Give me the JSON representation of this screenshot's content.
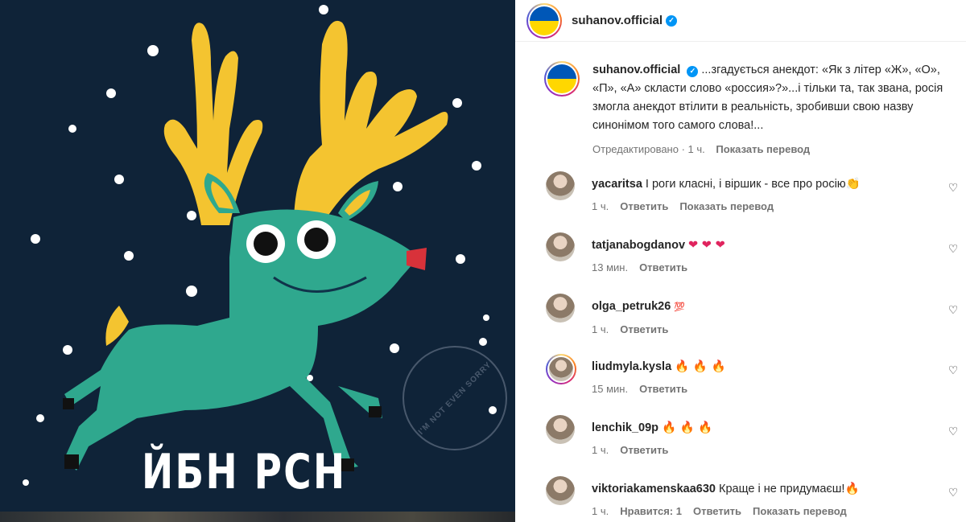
{
  "media": {
    "caption": "ЙБН РСН",
    "watermark": "I'M NOT EVEN SORRY"
  },
  "header": {
    "username": "suhanov.official",
    "verified_icon": "verified-badge-icon"
  },
  "post_caption": {
    "username": "suhanov.official",
    "text": "...згадується анекдот: «Як з літер «Ж», «О», «П», «А» скласти слово «россия»?»...і тільки та, так звана, росія змогла анекдот втілити в реальність, зробивши свою назву синонімом того самого слова!...",
    "edited": "Отредактировано",
    "time": "· 1 ч.",
    "translate": "Показать перевод"
  },
  "comments": [
    {
      "username": "yacaritsa",
      "text": "І роги класні, і віршик - все про росію",
      "emoji": "👏",
      "emoji_color": "#f4b400",
      "time": "1 ч.",
      "likes": "",
      "reply": "Ответить",
      "translate": "Показать перевод"
    },
    {
      "username": "tatjanabogdanov",
      "text": "",
      "emoji": "❤ ❤ ❤",
      "emoji_color": "#e0245e",
      "time": "13 мин.",
      "likes": "",
      "reply": "Ответить",
      "translate": ""
    },
    {
      "username": "olga_petruk26",
      "text": "",
      "emoji": "💯",
      "emoji_color": "#e0245e",
      "time": "1 ч.",
      "likes": "",
      "reply": "Ответить",
      "translate": ""
    },
    {
      "username": "liudmyla.kysla",
      "text": "",
      "emoji": "🔥 🔥 🔥",
      "emoji_color": "#f36b1c",
      "time": "15 мин.",
      "likes": "",
      "reply": "Ответить",
      "translate": ""
    },
    {
      "username": "lenchik_09p",
      "text": "",
      "emoji": "🔥 🔥 🔥",
      "emoji_color": "#f36b1c",
      "time": "1 ч.",
      "likes": "",
      "reply": "Ответить",
      "translate": ""
    },
    {
      "username": "viktoriakamenskaa630",
      "text": "Краще і не придумаєш!",
      "emoji": "🔥",
      "emoji_color": "#f36b1c",
      "time": "1 ч.",
      "likes": "Нравится: 1",
      "reply": "Ответить",
      "translate": "Показать перевод"
    }
  ],
  "icons": {
    "like": "heart-outline-icon"
  }
}
